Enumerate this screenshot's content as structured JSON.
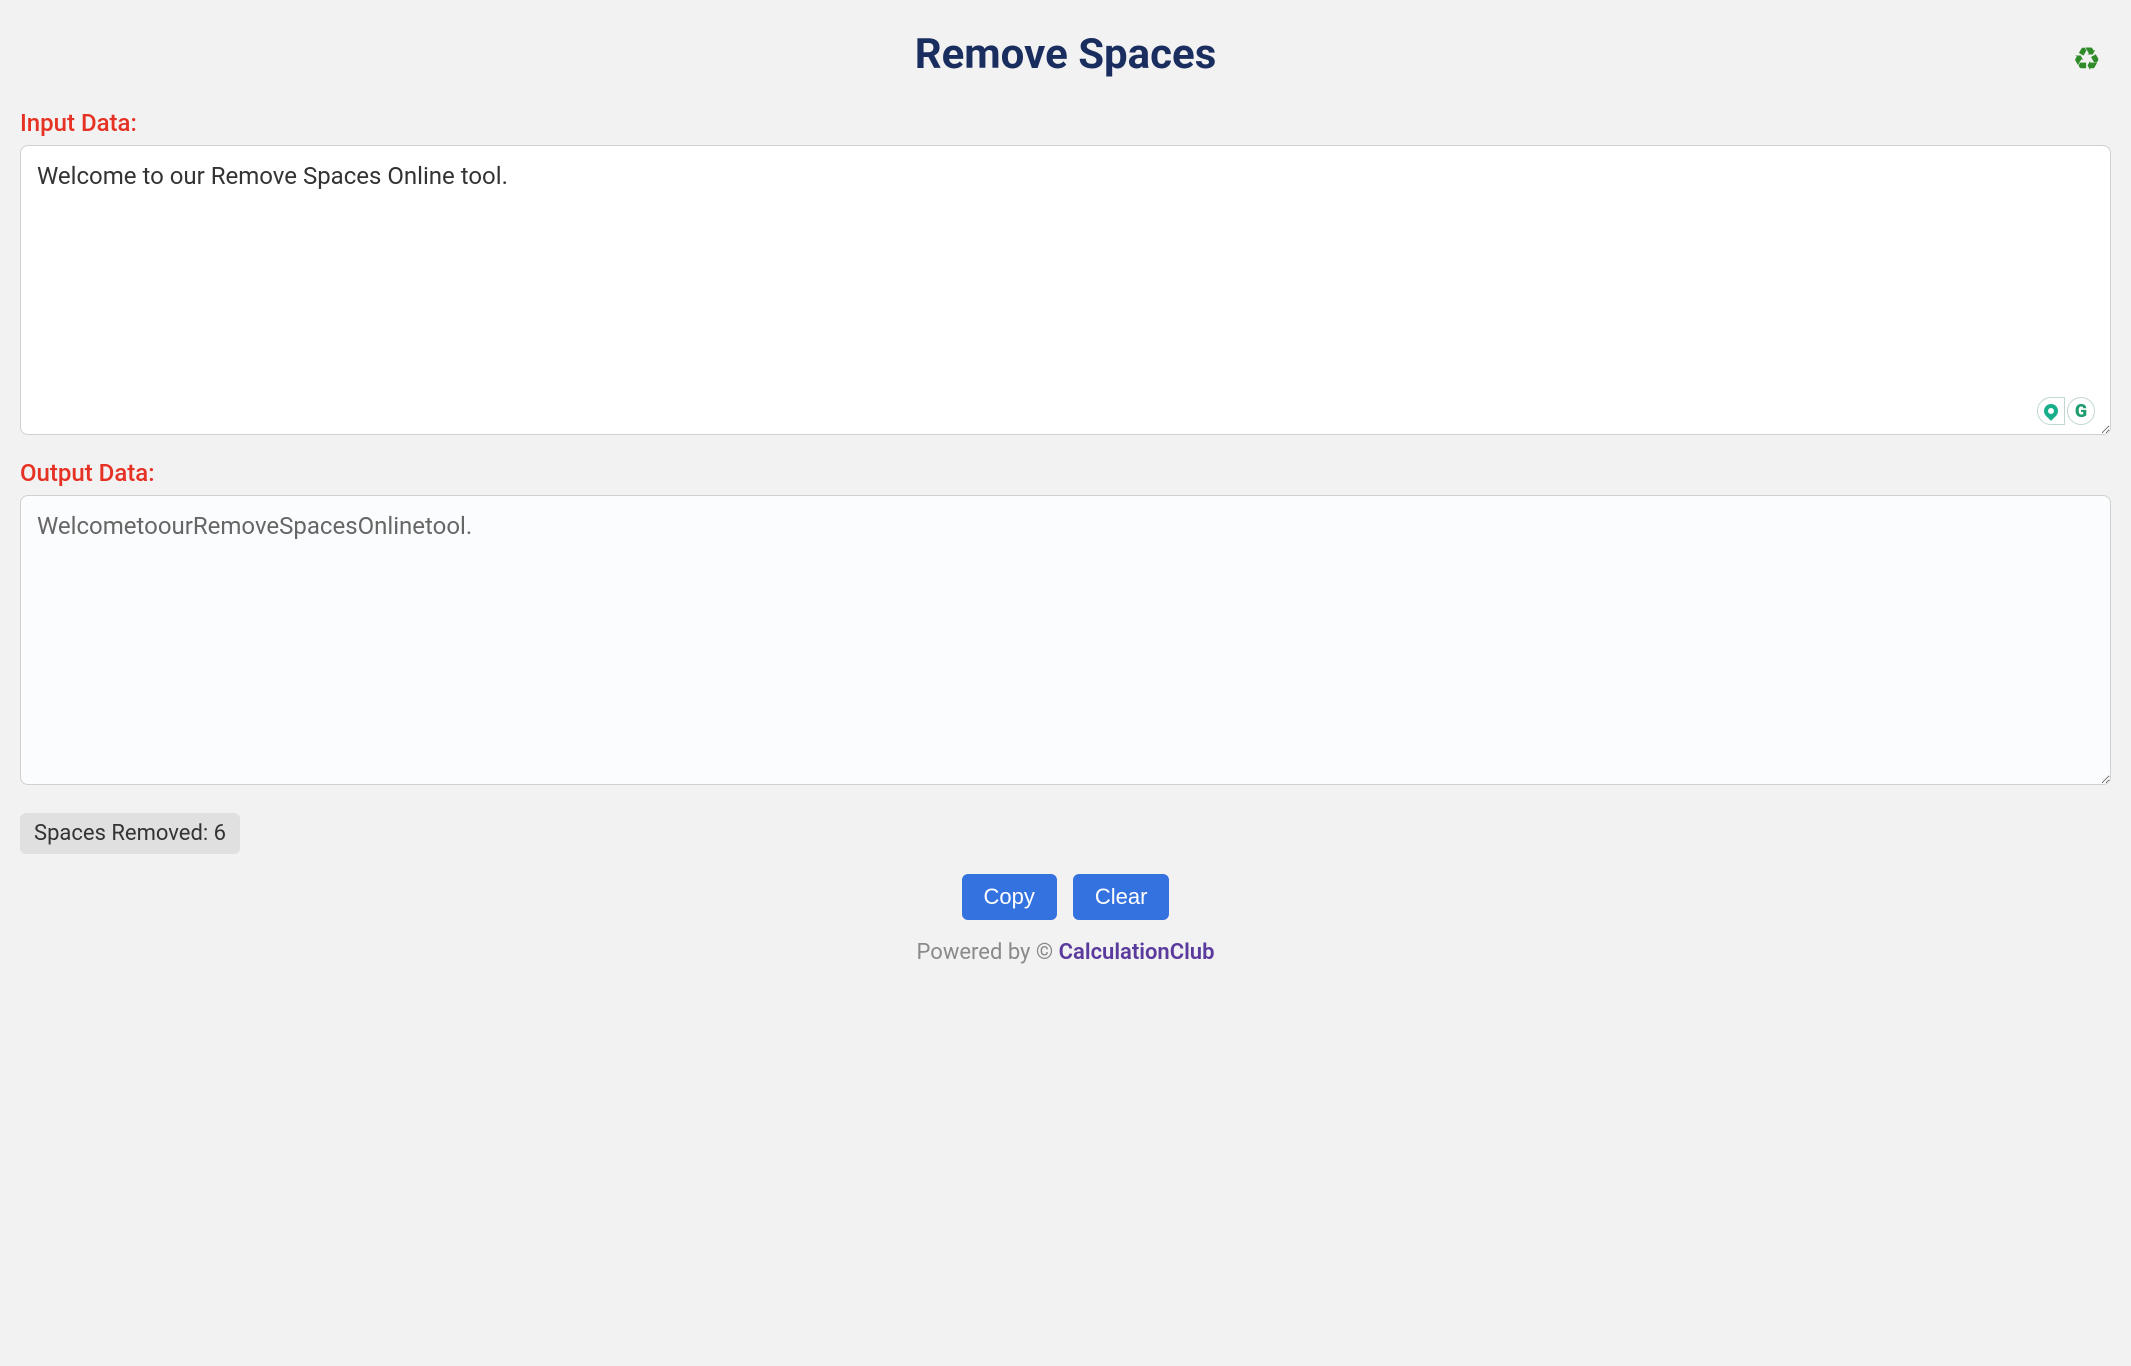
{
  "header": {
    "title": "Remove Spaces"
  },
  "input": {
    "label": "Input Data:",
    "value": "Welcome to our Remove Spaces Online tool."
  },
  "output": {
    "label": "Output Data:",
    "value": "WelcometoourRemoveSpacesOnlinetool."
  },
  "status": {
    "spaces_removed_label": "Spaces Removed: 6"
  },
  "buttons": {
    "copy": "Copy",
    "clear": "Clear"
  },
  "footer": {
    "powered_by": "Powered by © ",
    "brand": "CalculationClub"
  },
  "icons": {
    "recycle": "♻"
  }
}
